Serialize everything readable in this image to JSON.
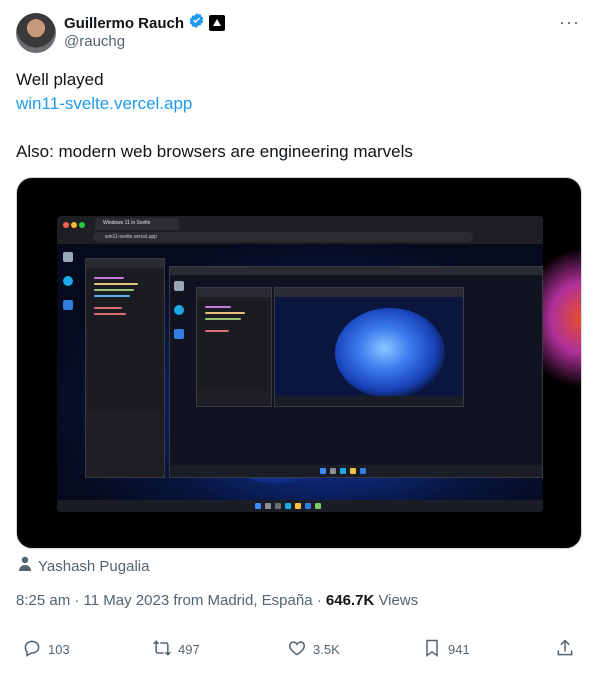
{
  "header": {
    "display_name": "Guillermo Rauch",
    "handle": "@rauchg",
    "more_label": "···",
    "avatar_icon": "avatar-photo",
    "verified_icon": "verified-badge-icon",
    "affiliate_icon": "vercel-triangle-icon"
  },
  "tweet": {
    "line1": "Well played",
    "link": "win11-svelte.vercel.app",
    "line3": "Also: modern web browsers are engineering marvels"
  },
  "media": {
    "browser_tab": "Windows 11 in Svelte",
    "browser_url": "win11-svelte.vercel.app",
    "person_icon": "person-icon",
    "tagged_user": "Yashash Pugalia"
  },
  "meta": {
    "time": "8:25 am",
    "date": "11 May 2023 from Madrid, España",
    "views_count": "646.7K",
    "views_label": "Views",
    "sep1": " · ",
    "sep2": " · "
  },
  "actions": {
    "replies": "103",
    "retweets": "497",
    "likes": "3.5K",
    "bookmarks": "941"
  },
  "colors": {
    "accent": "#1d9bf0",
    "text_primary": "#0f1419",
    "text_secondary": "#536471"
  }
}
